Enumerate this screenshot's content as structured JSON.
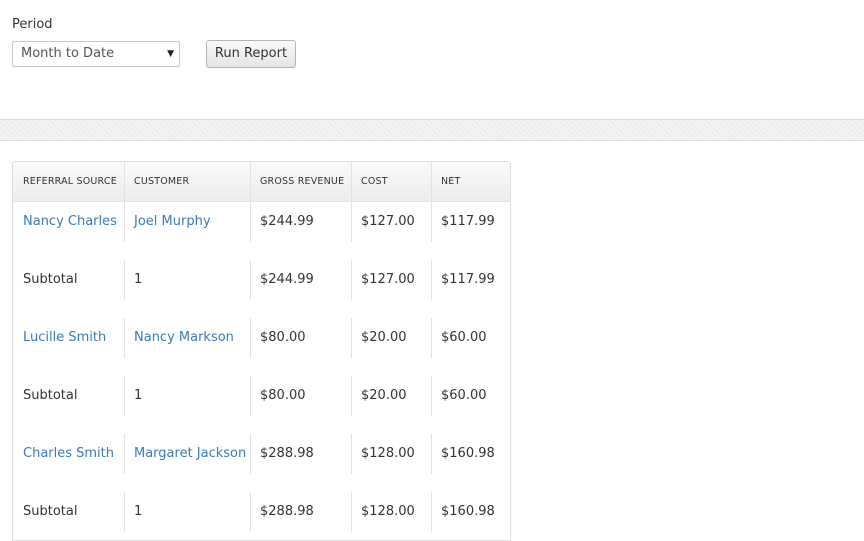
{
  "filter": {
    "period_label": "Period",
    "period_value": "Month to Date",
    "run_button_label": "Run Report"
  },
  "table": {
    "headers": [
      "REFERRAL SOURCE",
      "CUSTOMER",
      "GROSS REVENUE",
      "COST",
      "NET"
    ],
    "rows": [
      {
        "type": "detail",
        "cells": [
          "Nancy Charles",
          "Joel Murphy",
          "$244.99",
          "$127.00",
          "$117.99"
        ]
      },
      {
        "type": "subtotal",
        "cells": [
          "Subtotal",
          "1",
          "$244.99",
          "$127.00",
          "$117.99"
        ]
      },
      {
        "type": "detail",
        "cells": [
          "Lucille Smith",
          "Nancy Markson",
          "$80.00",
          "$20.00",
          "$60.00"
        ]
      },
      {
        "type": "subtotal",
        "cells": [
          "Subtotal",
          "1",
          "$80.00",
          "$20.00",
          "$60.00"
        ]
      },
      {
        "type": "detail",
        "cells": [
          "Charles Smith",
          "Margaret Jackson",
          "$288.98",
          "$128.00",
          "$160.98"
        ]
      },
      {
        "type": "subtotal",
        "cells": [
          "Subtotal",
          "1",
          "$288.98",
          "$128.00",
          "$160.98"
        ]
      }
    ]
  },
  "colors": {
    "link": "#3a7ab8",
    "text": "#333333"
  },
  "icons": {
    "select_caret": "caret-down-icon"
  }
}
